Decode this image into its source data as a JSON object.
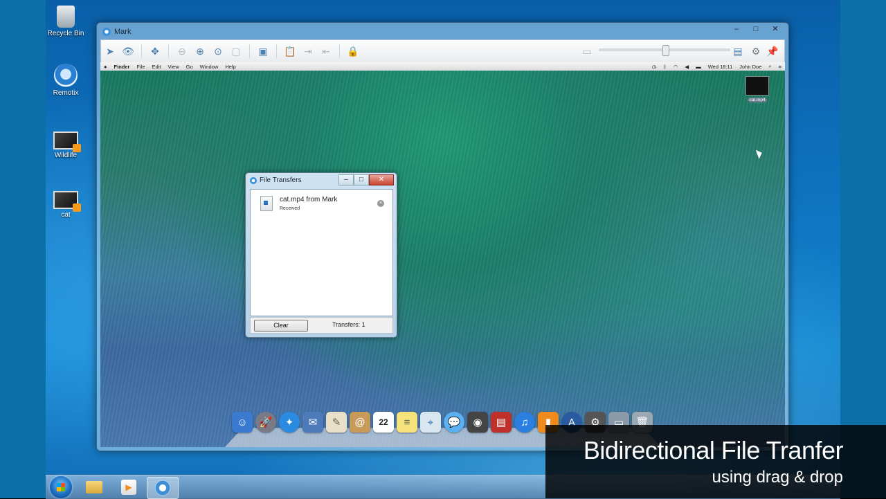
{
  "desktop": {
    "icons": [
      {
        "label": "Recycle Bin"
      },
      {
        "label": "Remotix"
      },
      {
        "label": "Wildlife"
      },
      {
        "label": "cat"
      }
    ]
  },
  "window": {
    "title": "Mark",
    "controls": {
      "minimize": "–",
      "maximize": "□",
      "close": "✕"
    }
  },
  "mac": {
    "menu": [
      "Finder",
      "File",
      "Edit",
      "View",
      "Go",
      "Window",
      "Help"
    ],
    "clock": "Wed 18:11",
    "user": "John Doe",
    "desktop_file": "cat.mp4",
    "dock_calendar_day": "22"
  },
  "file_transfers": {
    "title": "File Transfers",
    "item_name": "cat.mp4 from Mark",
    "item_status": "Received",
    "clear_label": "Clear",
    "count_label": "Transfers: 1"
  },
  "caption": {
    "title": "Bidirectional File Tranfer",
    "subtitle": "using drag & drop"
  },
  "colors": {
    "accent": "#3a8fd8"
  }
}
